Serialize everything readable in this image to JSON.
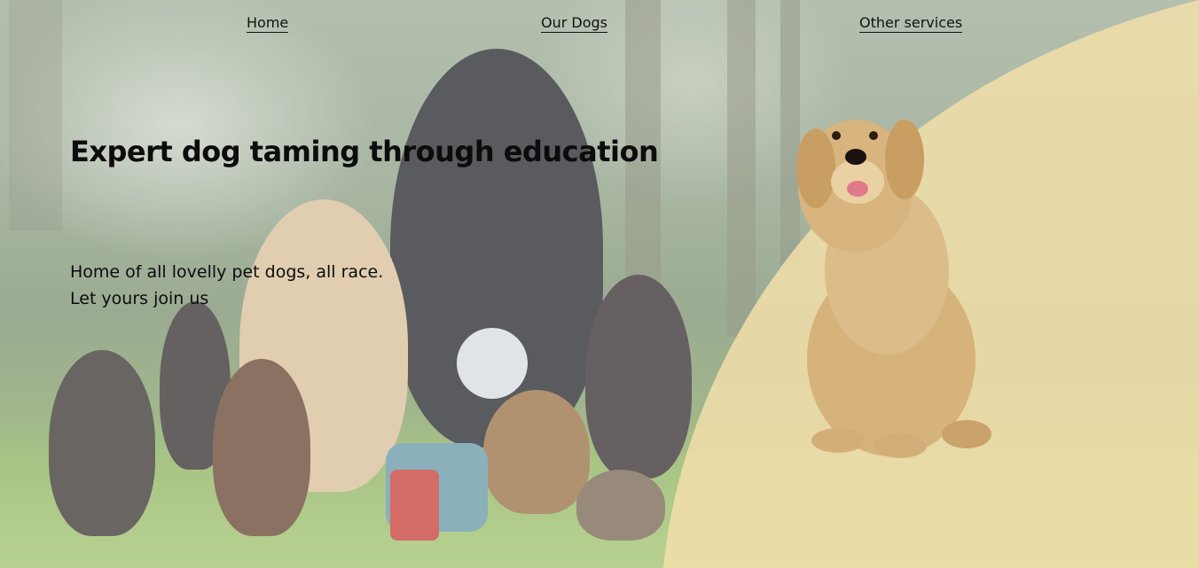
{
  "nav": {
    "items": [
      {
        "label": "Home"
      },
      {
        "label": "Our Dogs"
      },
      {
        "label": "Other services"
      }
    ]
  },
  "hero": {
    "headline": "Expert dog taming through education",
    "tagline_line1": "Home of all lovelly pet dogs, all race.",
    "tagline_line2": "Let yours join us"
  },
  "colors": {
    "accent_panel": "#f2deaa",
    "text": "#0c0c0c"
  },
  "images": {
    "background": "group-of-dogs-photo",
    "featured": "golden-retriever-photo"
  }
}
